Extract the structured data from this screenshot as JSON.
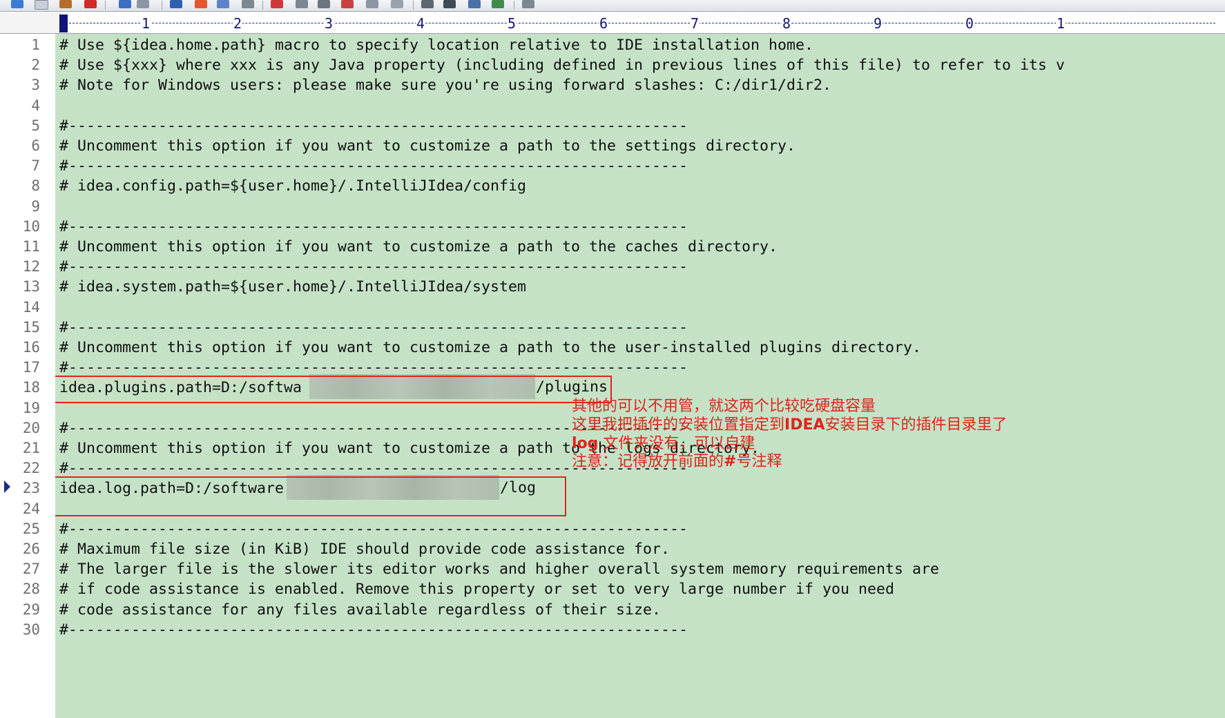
{
  "toolbar": {
    "icons": [
      "cut-icon",
      "copy-icon",
      "save-icon",
      "delete-icon",
      "tool-icon",
      "find-icon",
      "replace-icon",
      "document-icon",
      "format-icon",
      "spell-check-icon",
      "settings-icon",
      "window-icon",
      "window-icon-2",
      "view-icon",
      "export-icon",
      "run-icon"
    ]
  },
  "ruler": {
    "labels": [
      "1",
      "2",
      "3",
      "4",
      "5",
      "6",
      "7",
      "8",
      "9",
      "0",
      "1"
    ]
  },
  "editor": {
    "current_line": 23,
    "line_numbers": [
      "1",
      "2",
      "3",
      "4",
      "5",
      "6",
      "7",
      "8",
      "9",
      "10",
      "11",
      "12",
      "13",
      "14",
      "15",
      "16",
      "17",
      "18",
      "19",
      "20",
      "21",
      "22",
      "23",
      "24",
      "25",
      "26",
      "27",
      "28",
      "29",
      "30"
    ],
    "lines": [
      "# Use ${idea.home.path} macro to specify location relative to IDE installation home.",
      "# Use ${xxx} where xxx is any Java property (including defined in previous lines of this file) to refer to its v",
      "# Note for Windows users: please make sure you're using forward slashes: C:/dir1/dir2.",
      "",
      "#---------------------------------------------------------------------",
      "# Uncomment this option if you want to customize a path to the settings directory.",
      "#---------------------------------------------------------------------",
      "# idea.config.path=${user.home}/.IntelliJIdea/config",
      "",
      "#---------------------------------------------------------------------",
      "# Uncomment this option if you want to customize a path to the caches directory.",
      "#---------------------------------------------------------------------",
      "# idea.system.path=${user.home}/.IntelliJIdea/system",
      "",
      "#---------------------------------------------------------------------",
      "# Uncomment this option if you want to customize a path to the user-installed plugins directory.",
      "#---------------------------------------------------------------------",
      "idea.plugins.path=D:/softwa",
      "",
      "#---------------------------------------------------------------------",
      "# Uncomment this option if you want to customize a path to the logs directory.",
      "#---------------------------------------------------------------------",
      "idea.log.path=D:/software",
      "",
      "#---------------------------------------------------------------------",
      "# Maximum file size (in KiB) IDE should provide code assistance for.",
      "# The larger file is the slower its editor works and higher overall system memory requirements are",
      "# if code assistance is enabled. Remove this property or set to very large number if you need",
      "# code assistance for any files available regardless of their size.",
      "#---------------------------------------------------------------------"
    ],
    "plugins_suffix": "/plugins",
    "log_suffix": "/log"
  },
  "annotation": {
    "line1": "其他的可以不用管，就这两个比较吃硬盘容量",
    "line2_a": "这里我把插件的安装位置指定到",
    "line2_b": "IDEA",
    "line2_c": "安装目录下的插件目录里了",
    "line3_a": "log",
    "line3_b": " 文件夹没有，可以自建",
    "line4_a": "注意：记得放开前面的",
    "line4_b": "#",
    "line4_c": "号注释",
    "color": "#e2231a"
  },
  "colors": {
    "editor_bg": "#c5e2c7",
    "highlight_box": "#e2231a",
    "ruler": "#10157a"
  }
}
